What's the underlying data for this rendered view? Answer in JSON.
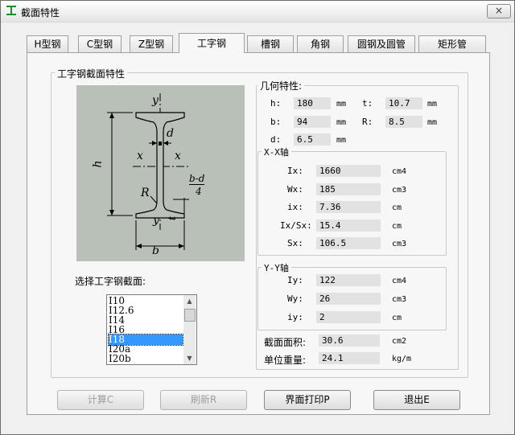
{
  "window": {
    "title": "截面特性",
    "close_label": "×"
  },
  "tabs": [
    "H型钢",
    "C型钢",
    "Z型钢",
    "工字钢",
    "槽钢",
    "角钢",
    "圆钢及圆管",
    "矩形管"
  ],
  "section_group_title": "工字钢截面特性",
  "diagram_labels": {
    "y_top": "y",
    "y_bottom": "y",
    "x_left": "x",
    "x_right": "x",
    "d": "d",
    "h": "h",
    "R": "R",
    "t": "t",
    "b": "b",
    "bd_num": "b-d",
    "bd_den": "4"
  },
  "select_label": "选择工字钢截面:",
  "sections": [
    "I10",
    "I12.6",
    "I14",
    "I16",
    "I18",
    "I20a",
    "I20b"
  ],
  "selected_section": "I18",
  "geometry": {
    "title": "几何特性:",
    "h": {
      "label": "h:",
      "value": "180",
      "unit": "mm"
    },
    "t": {
      "label": "t:",
      "value": "10.7",
      "unit": "mm"
    },
    "b": {
      "label": "b:",
      "value": "94",
      "unit": "mm"
    },
    "R": {
      "label": "R:",
      "value": "8.5",
      "unit": "mm"
    },
    "d": {
      "label": "d:",
      "value": "6.5",
      "unit": "mm"
    }
  },
  "xx": {
    "title": "X-X轴",
    "Ix": {
      "label": "Ix:",
      "value": "1660",
      "unit": "cm4"
    },
    "Wx": {
      "label": "Wx:",
      "value": "185",
      "unit": "cm3"
    },
    "ix": {
      "label": "ix:",
      "value": "7.36",
      "unit": "cm"
    },
    "IxSx": {
      "label": "Ix/Sx:",
      "value": "15.4",
      "unit": "cm"
    },
    "Sx": {
      "label": "Sx:",
      "value": "106.5",
      "unit": "cm3"
    }
  },
  "yy": {
    "title": "Y-Y轴",
    "Iy": {
      "label": "Iy:",
      "value": "122",
      "unit": "cm4"
    },
    "Wy": {
      "label": "Wy:",
      "value": "26",
      "unit": "cm3"
    },
    "iy": {
      "label": "iy:",
      "value": "2",
      "unit": "cm"
    }
  },
  "area": {
    "label": "截面面积:",
    "value": "30.6",
    "unit": "cm2"
  },
  "weight": {
    "label": "单位重量:",
    "value": "24.1",
    "unit": "kg/m"
  },
  "buttons": {
    "calc": "计算C",
    "refresh": "刷新R",
    "print": "界面打印P",
    "exit": "退出E"
  }
}
